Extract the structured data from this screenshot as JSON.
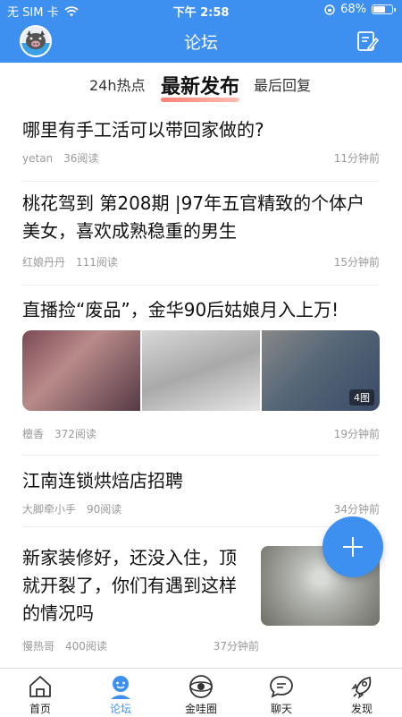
{
  "status": {
    "carrier": "无 SIM 卡",
    "time": "下午 2:58",
    "battery": "68%",
    "battery_level": 0.68
  },
  "header": {
    "title": "论坛"
  },
  "tabs": [
    {
      "label": "24h热点"
    },
    {
      "label": "最新发布"
    },
    {
      "label": "最后回复"
    }
  ],
  "posts": [
    {
      "title": "哪里有手工活可以带回家做的?",
      "author": "yetan",
      "reads": "36阅读",
      "time": "11分钟前"
    },
    {
      "title": "桃花驾到 第208期 |97年五官精致的个体户美女，喜欢成熟稳重的男生",
      "author": "红娘丹丹",
      "reads": "111阅读",
      "time": "15分钟前"
    },
    {
      "title": "直播捡“废品”，金华90后姑娘月入上万!",
      "author": "檀香",
      "reads": "372阅读",
      "time": "19分钟前",
      "image_count": "4图"
    },
    {
      "title": "江南连锁烘焙店招聘",
      "author": "大脚牵小手",
      "reads": "90阅读",
      "time": "34分钟前"
    },
    {
      "title": "新家装修好，还没入住，顶就开裂了，你们有遇到这样的情况吗",
      "author": "慢热哥",
      "reads": "400阅读",
      "time": "37分钟前"
    }
  ],
  "bottom_nav": [
    {
      "label": "首页",
      "icon": "home-icon"
    },
    {
      "label": "论坛",
      "icon": "forum-icon"
    },
    {
      "label": "金哇圈",
      "icon": "circle-icon"
    },
    {
      "label": "聊天",
      "icon": "chat-icon"
    },
    {
      "label": "发现",
      "icon": "rocket-icon"
    }
  ],
  "colors": {
    "brand": "#3d8ff0",
    "accent": "#ff6a5b",
    "muted": "#999999"
  }
}
